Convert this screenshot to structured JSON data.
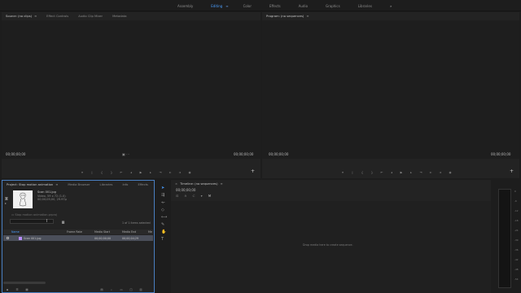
{
  "workspaces": {
    "tabs": [
      "Assembly",
      "Editing",
      "Color",
      "Effects",
      "Audio",
      "Graphics",
      "Libraries"
    ],
    "active": "Editing",
    "menu_glyph": "≡",
    "more_glyph": "»"
  },
  "source_panel": {
    "tabs": [
      "Source: (no clips)",
      "Effect Controls",
      "Audio Clip Mixer",
      "Metadata"
    ],
    "menu_glyph": "≡",
    "timecode_left": "00;00;00;00",
    "timecode_right": "00;00;00;00"
  },
  "program_panel": {
    "tab": "Program: (no sequences)",
    "menu_glyph": "≡",
    "timecode_left": "00;00;00;00",
    "timecode_right": "00;00;00;00"
  },
  "project_panel": {
    "tabs": [
      "Project: Stop motion animation",
      "Media Browser",
      "Libraries",
      "Info",
      "Effects"
    ],
    "menu_glyph": "≡",
    "clip": {
      "name": "Scan 001.jpg",
      "type": "Video, 59 x 72 (1.0)",
      "timecode": "00;00;05;00, 29.97p"
    },
    "bin_label": "Stop motion animation.prproj",
    "items_count": "1 of 1 items selected",
    "columns": [
      "Name",
      "Frame Rate",
      "Media Start",
      "Media End",
      "Me"
    ],
    "rows": [
      {
        "name": "Scan 001.jpg",
        "frame_rate": "",
        "media_start": "00;00;00;00",
        "media_end": "00;00;04;29"
      }
    ]
  },
  "timeline_panel": {
    "tab": "Timeline: (no sequences)",
    "menu_glyph": "≡",
    "timecode": "00;00;00;00",
    "drop_text": "Drop media here to create sequence."
  },
  "meters": {
    "db_labels": [
      "0",
      "-6",
      "-12",
      "-18",
      "-24",
      "-30",
      "-36",
      "-42",
      "-48",
      "-54"
    ]
  },
  "colors": {
    "accent": "#4a9eff",
    "clip_label": "#b78cff"
  }
}
